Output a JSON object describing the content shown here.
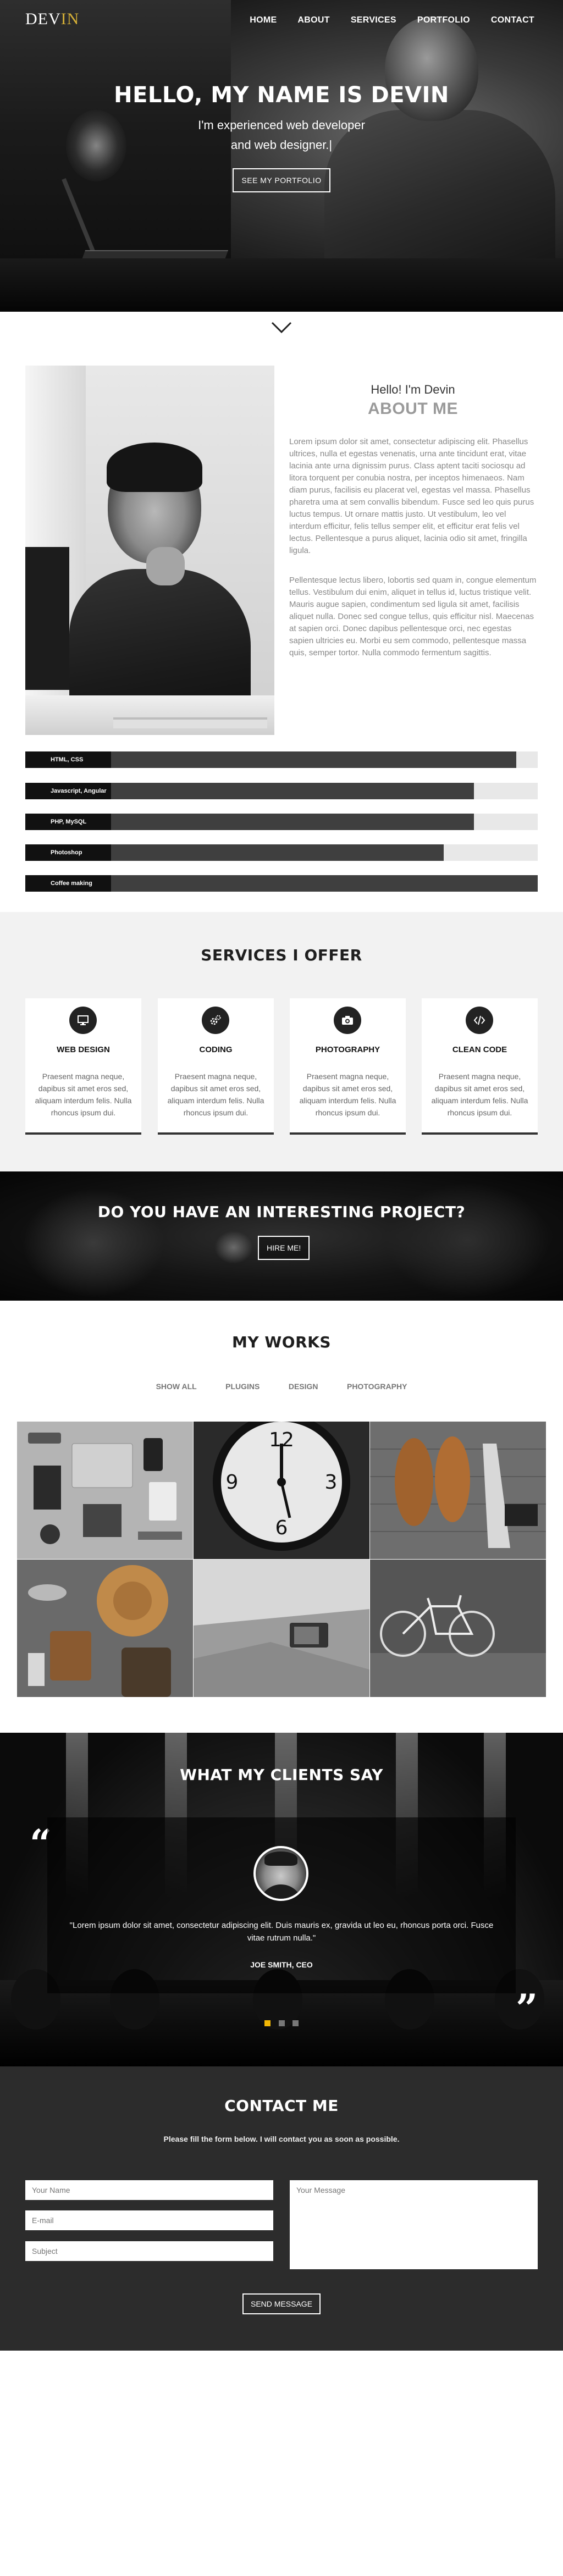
{
  "brand": {
    "logo_left": "DEV",
    "logo_accent": "IN"
  },
  "nav": {
    "items": [
      "HOME",
      "ABOUT",
      "SERVICES",
      "PORTFOLIO",
      "CONTACT"
    ]
  },
  "hero": {
    "title": "HELLO, MY NAME IS DEVIN",
    "subtitle_line1": "I'm experienced web developer",
    "subtitle_line2": "and web designer.|",
    "button": "SEE MY PORTFOLIO"
  },
  "about": {
    "greeting": "Hello! I'm Devin",
    "title": "ABOUT ME",
    "paragraph1": "Lorem ipsum dolor sit amet, consectetur adipiscing elit. Phasellus ultrices, nulla et egestas venenatis, urna ante tincidunt erat, vitae lacinia ante urna dignissim purus. Class aptent taciti sociosqu ad litora torquent per conubia nostra, per inceptos himenaeos. Nam diam purus, facilisis eu placerat vel, egestas vel massa. Phasellus pharetra uma at sem convallis bibendum. Fusce sed leo quis purus luctus tempus. Ut ornare mattis justo. Ut vestibulum, leo vel interdum efficitur, felis tellus semper elit, et efficitur erat felis vel lectus. Pellentesque a purus aliquet, lacinia odio sit amet, fringilla ligula.",
    "paragraph2": "Pellentesque lectus libero, lobortis sed quam in, congue elementum tellus. Vestibulum dui enim, aliquet in tellus id, luctus tristique velit. Mauris augue sapien, condimentum sed ligula sit amet, facilisis aliquet nulla. Donec sed congue tellus, quis efficitur nisl. Maecenas at sapien orci. Donec dapibus pellentesque orci, nec egestas sapien ultricies eu. Morbi eu sem commodo, pellentesque massa quis, semper tortor. Nulla commodo fermentum sagittis."
  },
  "skills": [
    {
      "label": "HTML, CSS",
      "level": 0.95
    },
    {
      "label": "Javascript, Angular",
      "level": 0.85
    },
    {
      "label": "PHP, MySQL",
      "level": 0.85
    },
    {
      "label": "Photoshop",
      "level": 0.78
    },
    {
      "label": "Coffee making",
      "level": 1.0
    }
  ],
  "services": {
    "title": "SERVICES I OFFER",
    "cards": [
      {
        "title": "WEB DESIGN",
        "icon": "monitor-icon",
        "text": "Praesent magna neque, dapibus sit amet eros sed, aliquam interdum felis. Nulla rhoncus ipsum dui."
      },
      {
        "title": "CODING",
        "icon": "gears-icon",
        "text": "Praesent magna neque, dapibus sit amet eros sed, aliquam interdum felis. Nulla rhoncus ipsum dui."
      },
      {
        "title": "PHOTOGRAPHY",
        "icon": "camera-icon",
        "text": "Praesent magna neque, dapibus sit amet eros sed, aliquam interdum felis. Nulla rhoncus ipsum dui."
      },
      {
        "title": "CLEAN CODE",
        "icon": "code-icon",
        "text": "Praesent magna neque, dapibus sit amet eros sed, aliquam interdum felis. Nulla rhoncus ipsum dui."
      }
    ]
  },
  "project": {
    "title": "DO YOU HAVE AN INTERESTING PROJECT?",
    "button": "HIRE ME!"
  },
  "works": {
    "title": "MY WORKS",
    "filters": [
      "SHOW ALL",
      "PLUGINS",
      "DESIGN",
      "PHOTOGRAPHY"
    ]
  },
  "testimonials": {
    "title": "WHAT MY CLIENTS SAY",
    "quote": "\"Lorem ipsum dolor sit amet, consectetur adipiscing elit. Duis mauris ex, gravida ut leo eu, rhoncus porta orci. Fusce vitae rutrum nulla.\"",
    "author": "JOE SMITH, CEO",
    "open_mark": "“",
    "close_mark": "”"
  },
  "contact": {
    "title": "CONTACT ME",
    "subtitle": "Please fill the form below. I will contact you as soon as possible.",
    "name_placeholder": "Your Name",
    "email_placeholder": "E-mail",
    "subject_placeholder": "Subject",
    "message_placeholder": "Your Message",
    "send_button": "SEND MESSAGE"
  },
  "colors": {
    "accent": "#d4af37",
    "dot_active": "#f2b705",
    "dark": "#2c2c2c"
  }
}
